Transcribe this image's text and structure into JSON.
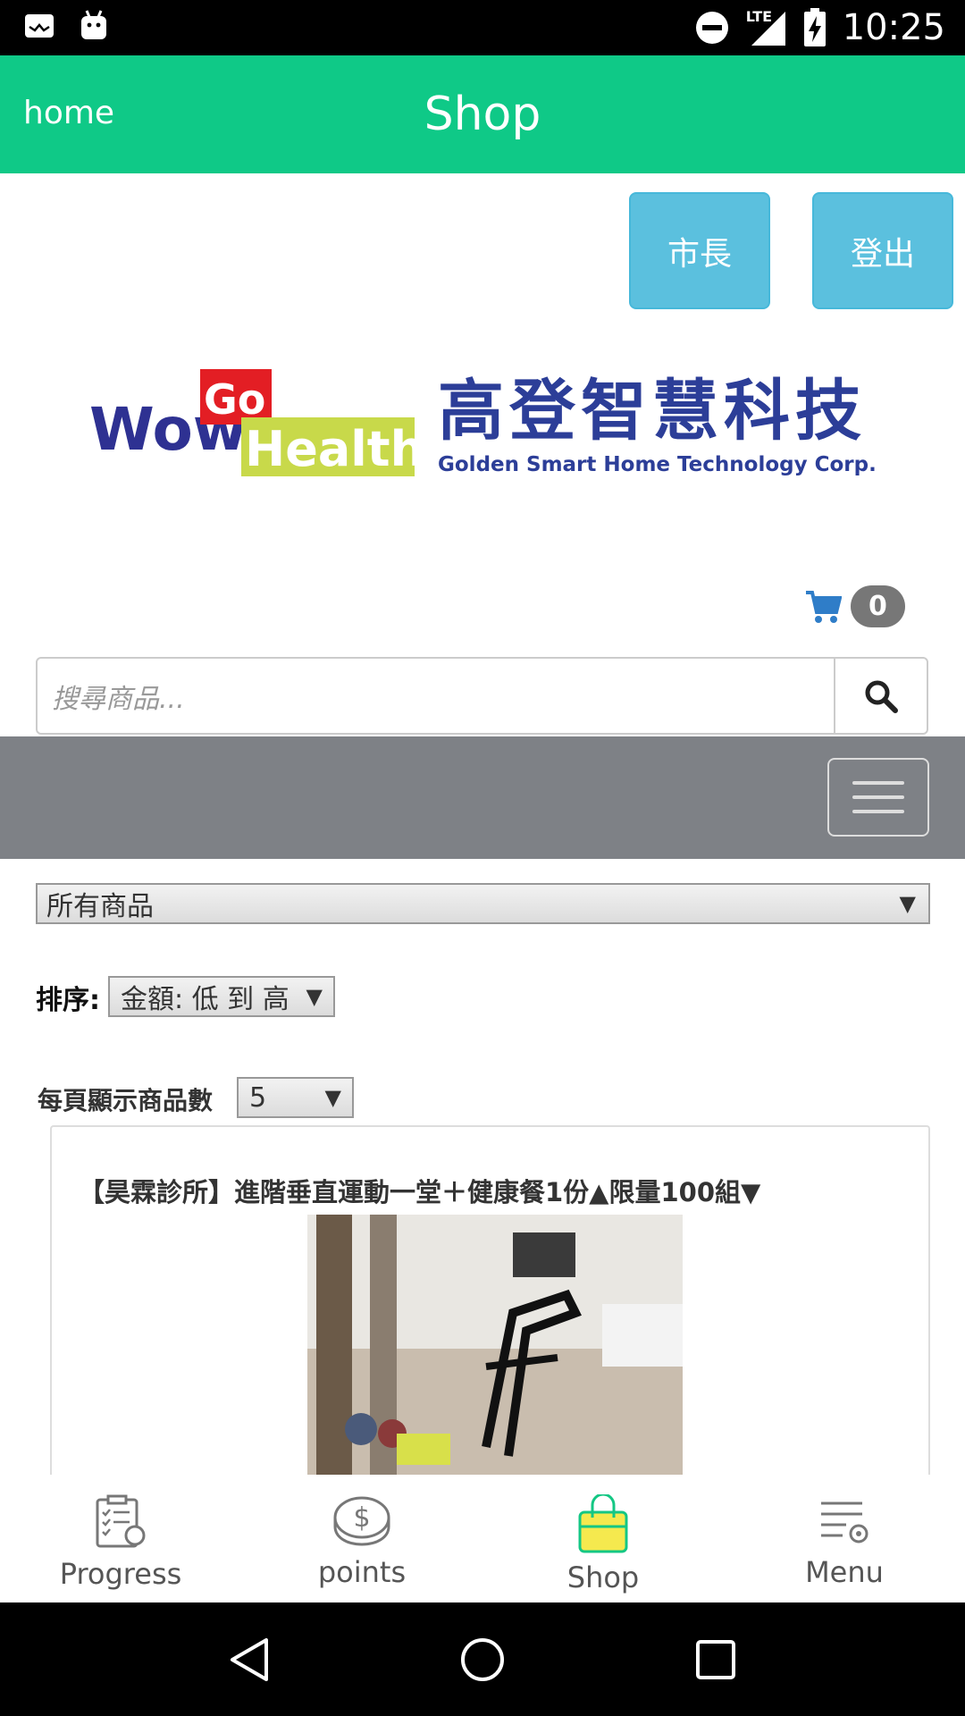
{
  "status_bar": {
    "network": "LTE",
    "time": "10:25"
  },
  "app_bar": {
    "home_label": "home",
    "title": "Shop"
  },
  "header_buttons": {
    "mayor_label": "市長",
    "logout_label": "登出"
  },
  "logo": {
    "brand_wow": "Wow",
    "brand_go": "Go",
    "brand_health": "Health",
    "company_zh": "高登智慧科技",
    "company_en": "Golden Smart Home Technology Corp."
  },
  "cart": {
    "count": "0"
  },
  "search": {
    "placeholder": "搜尋商品..."
  },
  "filters": {
    "category_selected": "所有商品",
    "sort_label": "排序:",
    "sort_selected": "金額: 低 到 高",
    "per_page_label": "每頁顯示商品數",
    "per_page_selected": "5"
  },
  "product": {
    "title": "【昊霖診所】進階垂直運動一堂＋健康餐1份▲限量100組▼"
  },
  "bottom_nav": {
    "items": [
      {
        "label": "Progress",
        "icon": "progress-clipboard-icon"
      },
      {
        "label": "points",
        "icon": "coin-dollar-icon"
      },
      {
        "label": "Shop",
        "icon": "shopping-bag-icon"
      },
      {
        "label": "Menu",
        "icon": "menu-settings-icon"
      }
    ]
  },
  "colors": {
    "app_bar": "#0fc987",
    "button": "#5bc0de",
    "nav_bar": "#7e8186",
    "shop_bag": "#f5e94e"
  }
}
